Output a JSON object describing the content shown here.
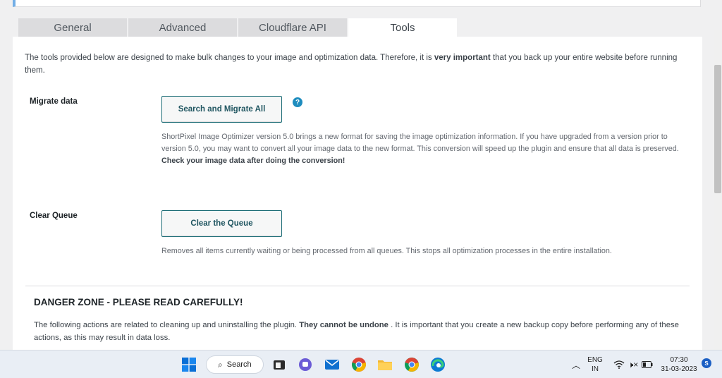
{
  "tabs": [
    {
      "label": "General",
      "active": false
    },
    {
      "label": "Advanced",
      "active": false
    },
    {
      "label": "Cloudflare API",
      "active": false
    },
    {
      "label": "Tools",
      "active": true
    }
  ],
  "intro": {
    "before": "The tools provided below are designed to make bulk changes to your image and optimization data. Therefore, it is ",
    "strong": "very important",
    "after": " that you back up your entire website before running them."
  },
  "migrate": {
    "label": "Migrate data",
    "button": "Search and Migrate All",
    "help": "?",
    "description": "ShortPixel Image Optimizer version 5.0 brings a new format for saving the image optimization information. If you have upgraded from a version prior to version 5.0, you may want to convert all your image data to the new format. This conversion will speed up the plugin and ensure that all data is preserved.",
    "note": "Check your image data after doing the conversion!"
  },
  "queue": {
    "label": "Clear Queue",
    "button": "Clear the Queue",
    "description": "Removes all items currently waiting or being processed from all queues. This stops all optimization processes in the entire installation."
  },
  "danger": {
    "title": "DANGER ZONE - PLEASE READ CAREFULLY!",
    "before": "The following actions are related to cleaning up and uninstalling the plugin. ",
    "strong": "They cannot be undone",
    "after": " . It is important that you create a new backup copy before performing any of these actions, as this may result in data loss."
  },
  "taskbar": {
    "search_label": "Search",
    "lang_top": "ENG",
    "lang_bottom": "IN",
    "time": "07:30",
    "date": "31-03-2023",
    "badge": "S",
    "icons": [
      "windows-start-icon",
      "search-icon",
      "file-explorer-icon",
      "teams-chat-icon",
      "mail-icon",
      "chrome-icon",
      "folder-icon",
      "chrome-alt-icon",
      "edge-icon",
      "chevron-up-icon",
      "wifi-icon",
      "volume-muted-icon",
      "battery-icon"
    ]
  }
}
